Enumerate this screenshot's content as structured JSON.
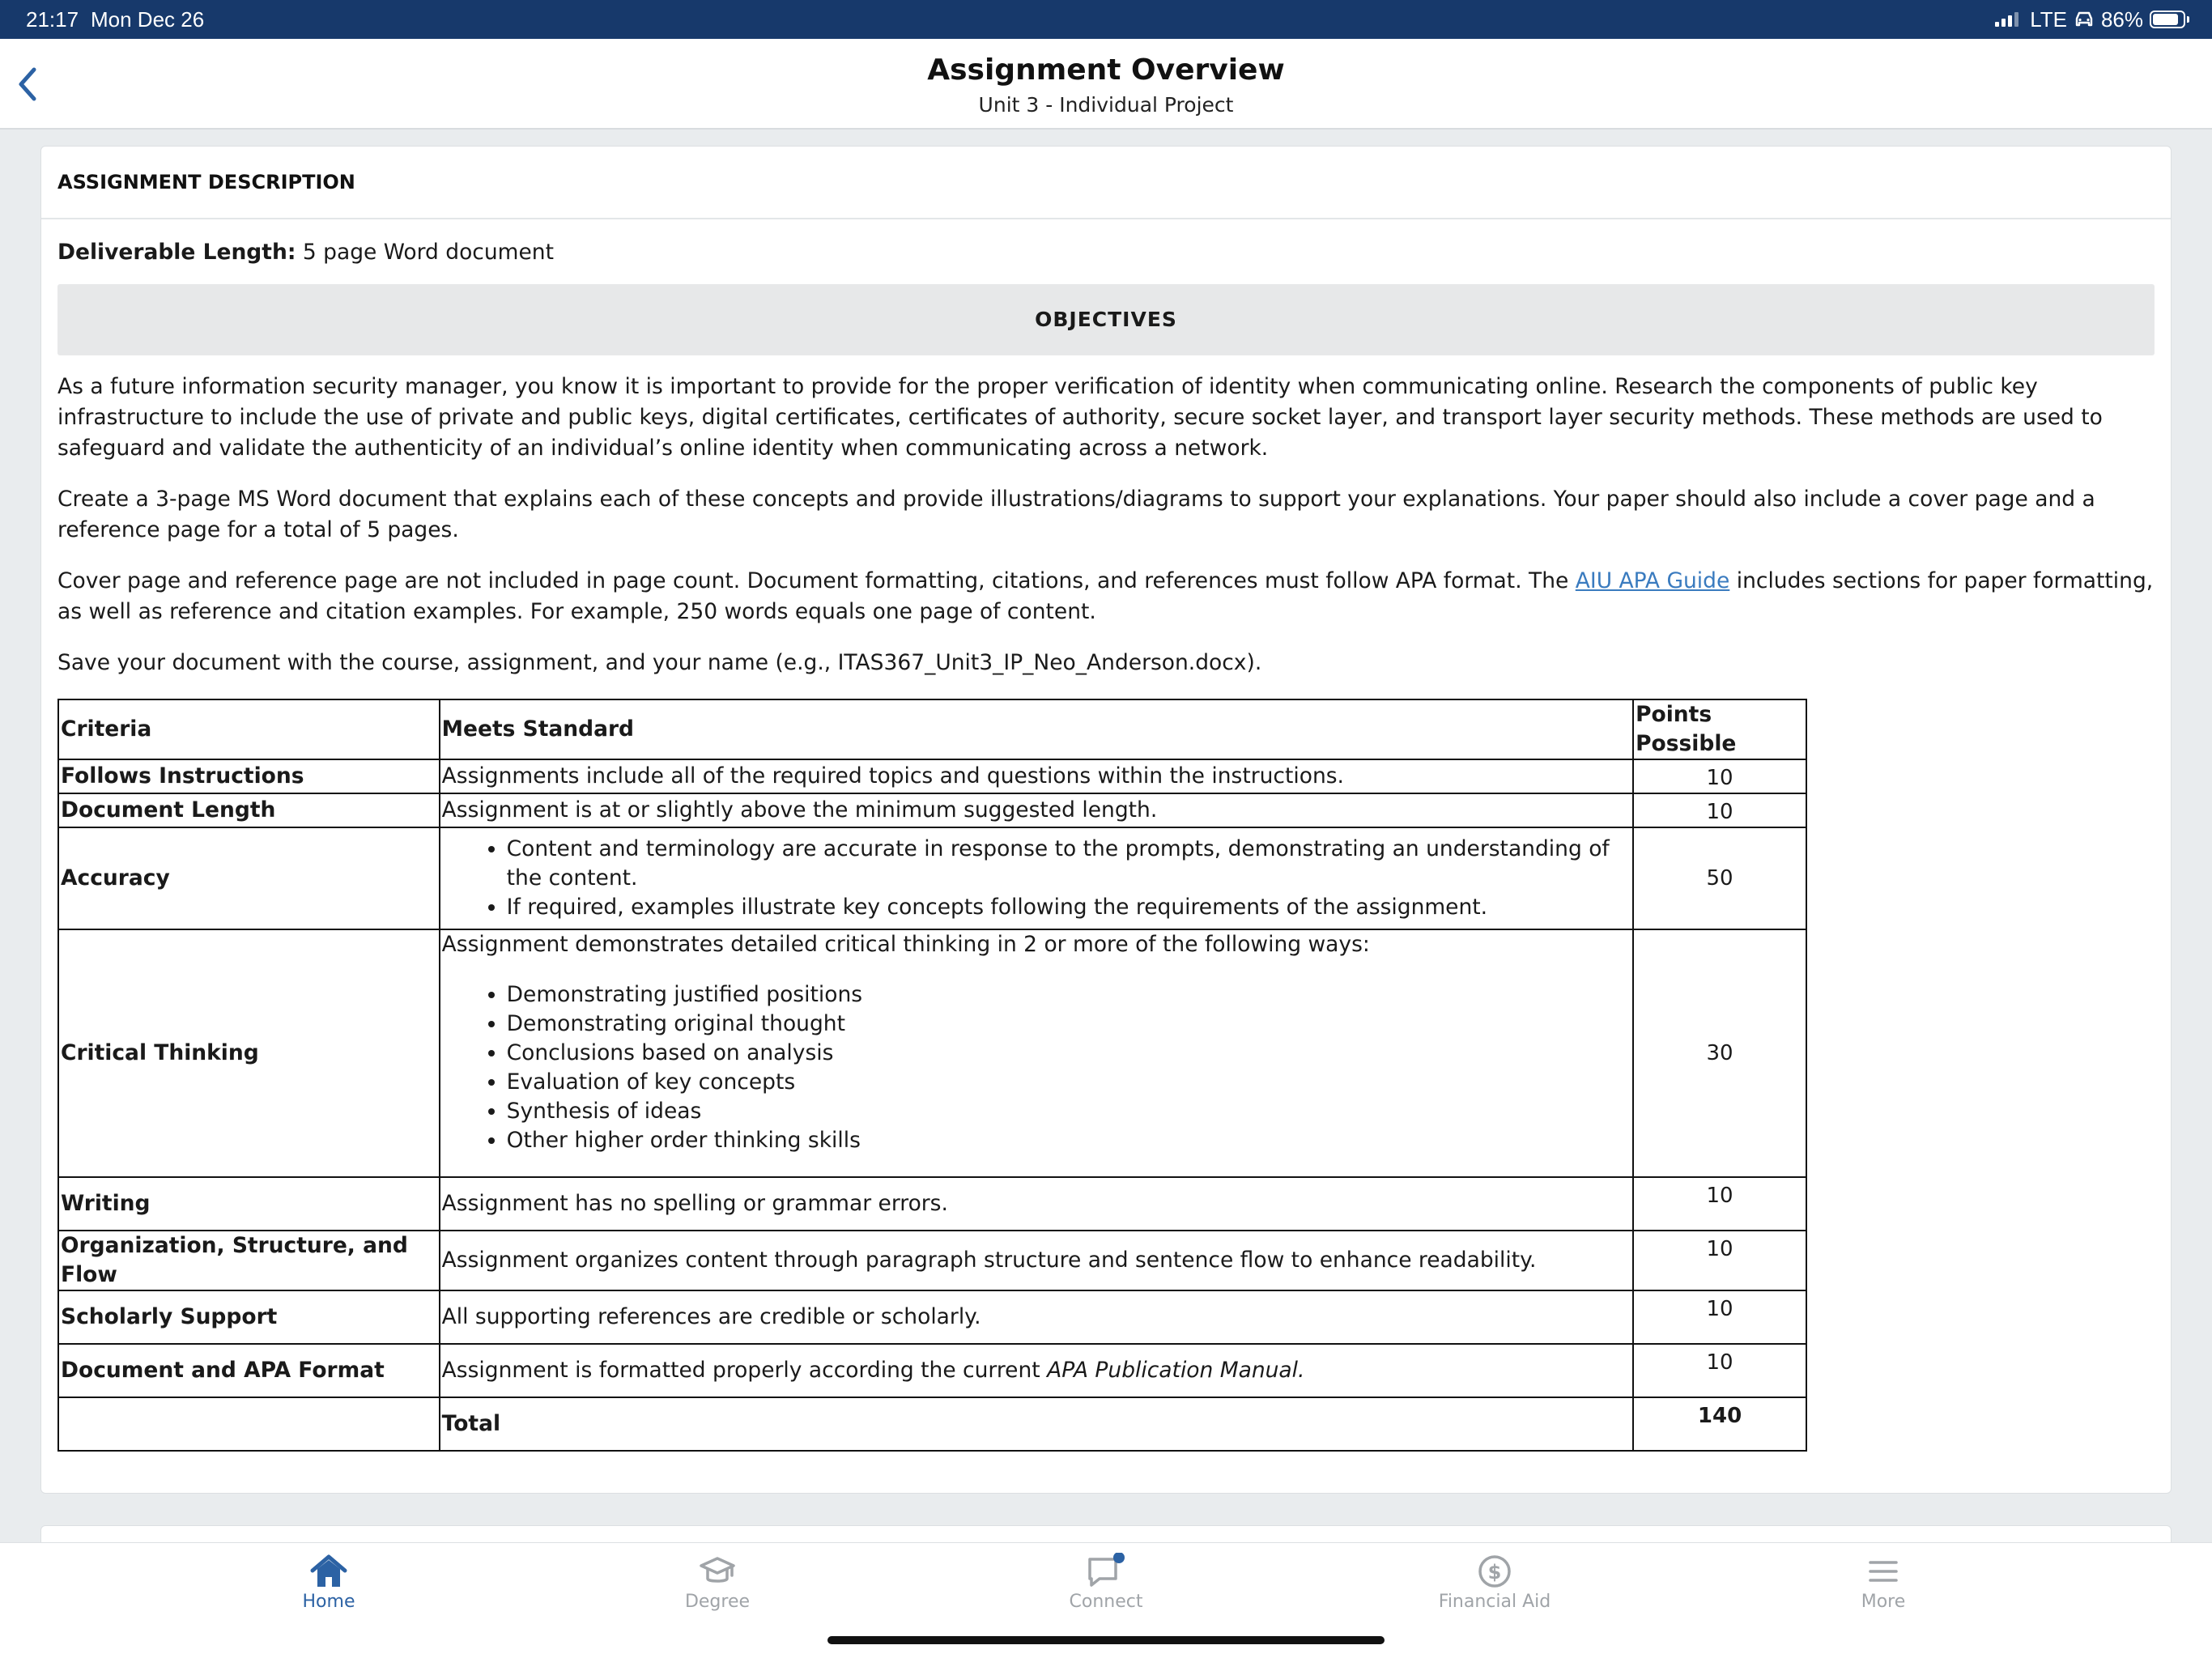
{
  "status_bar": {
    "time": "21:17",
    "date": "Mon Dec 26",
    "network": "LTE",
    "battery": "86%",
    "battery_level": 0.86
  },
  "header": {
    "title": "Assignment Overview",
    "subtitle": "Unit 3 - Individual Project"
  },
  "card": {
    "section_title": "ASSIGNMENT DESCRIPTION",
    "deliverable_label": "Deliverable Length:",
    "deliverable_value": " 5 page Word document",
    "objectives_label": "OBJECTIVES",
    "para1": "As a future information security manager, you know it is important to provide for the proper verification of identity when communicating online. Research the components of public key infrastructure to include the use of private and public keys, digital certificates, certificates of authority, secure socket layer, and transport layer security methods. These methods are used to safeguard and validate the authenticity of an individual’s online identity when communicating across a network.",
    "para2": "Create a 3-page MS Word document that explains each of these concepts and provide illustrations/diagrams to support your explanations. Your paper should also include a cover page and a reference page for a total of 5 pages.",
    "para3_before": "Cover page and reference page are not included in page count. Document formatting, citations, and references must follow APA format. The ",
    "para3_link": "AIU APA Guide",
    "para3_after": " includes sections for paper formatting, as well as reference and citation examples. For example, 250 words equals one page of content.",
    "para4": "Save your document with the course, assignment, and your name (e.g., ITAS367_Unit3_IP_Neo_Anderson.docx).",
    "rubric": {
      "headers": [
        "Criteria",
        "Meets Standard",
        "Points Possible"
      ],
      "rows": [
        {
          "criteria": "Follows Instructions",
          "standard": "Assignments include all of the required topics and questions within the instructions.",
          "points": "10"
        },
        {
          "criteria": "Document Length",
          "standard": "Assignment is at or slightly above the minimum suggested length.",
          "points": "10"
        },
        {
          "criteria": "Accuracy",
          "bullets": [
            "Content and terminology are accurate in response to the prompts, demonstrating an understanding of the content.",
            "If required, examples illustrate key concepts following the requirements of the assignment."
          ],
          "points": "50"
        },
        {
          "criteria": "Critical Thinking",
          "intro": "Assignment demonstrates detailed critical thinking in 2 or more of the following ways:",
          "bullets": [
            "Demonstrating justified positions",
            "Demonstrating original thought",
            "Conclusions based on analysis",
            "Evaluation of key concepts",
            "Synthesis of ideas",
            "Other higher order thinking skills"
          ],
          "points": "30"
        },
        {
          "criteria": "Writing",
          "standard": "Assignment has no spelling or grammar errors.",
          "points": "10"
        },
        {
          "criteria": "Organization, Structure, and Flow",
          "standard": "Assignment organizes content through paragraph structure and sentence flow to enhance readability.",
          "points": "10"
        },
        {
          "criteria": "Scholarly Support",
          "standard": "All supporting references are credible or scholarly.",
          "points": "10"
        },
        {
          "criteria": "Document and APA Format",
          "standard_before": "Assignment is formatted properly according the current ",
          "standard_italic": "APA Publication Manual.",
          "points": "10"
        }
      ],
      "total_label": "Total",
      "total_points": "140"
    }
  },
  "tabs": [
    {
      "label": "Home",
      "icon": "home-icon",
      "active": true
    },
    {
      "label": "Degree",
      "icon": "graduation-cap-icon",
      "active": false
    },
    {
      "label": "Connect",
      "icon": "chat-bubble-icon",
      "active": false,
      "badge": true
    },
    {
      "label": "Financial Aid",
      "icon": "dollar-circle-icon",
      "active": false
    },
    {
      "label": "More",
      "icon": "menu-icon",
      "active": false
    }
  ],
  "colors": {
    "status_bar": "#17396b",
    "accent": "#2c62a4",
    "link": "#3a7bbf",
    "inactive_tab": "#a0a4a8"
  }
}
